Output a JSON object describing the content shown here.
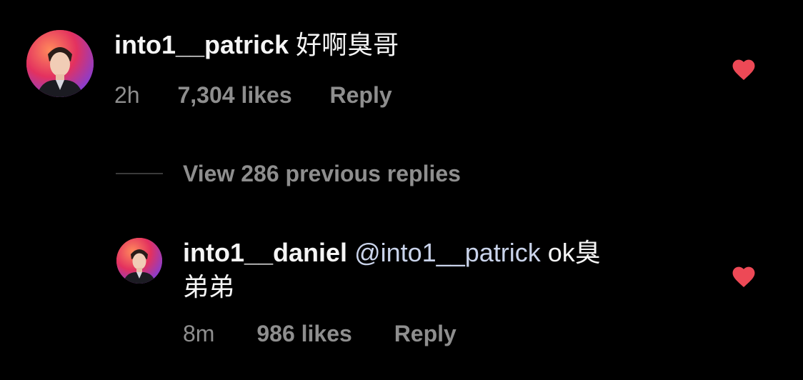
{
  "comment": {
    "username": "into1__patrick",
    "text": "好啊臭哥",
    "time": "2h",
    "likes": "7,304 likes",
    "reply_label": "Reply",
    "liked": true
  },
  "view_replies": {
    "label": "View 286 previous replies"
  },
  "reply": {
    "username": "into1__daniel",
    "mention": "@into1__patrick",
    "text_line1": "ok臭",
    "text_line2": "弟弟",
    "time": "8m",
    "likes": "986 likes",
    "reply_label": "Reply",
    "liked": true
  },
  "colors": {
    "background": "#000000",
    "primary_text": "#f5f5f5",
    "secondary_text": "#8e8e8e",
    "mention": "#c9d3ea",
    "heart": "#ed4956"
  }
}
